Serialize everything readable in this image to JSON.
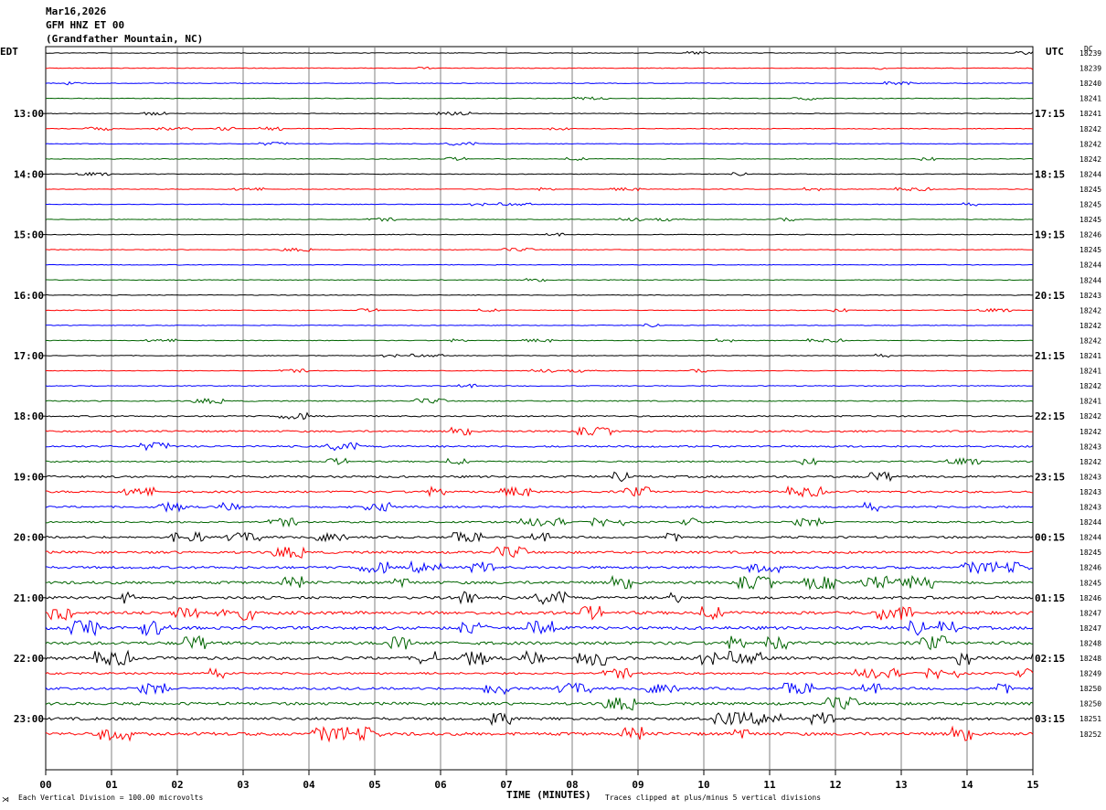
{
  "header": {
    "date": "Mar16,2026",
    "station": "GFM HNZ ET 00",
    "location": "(Grandfather Mountain, NC)"
  },
  "left_tz": "EDT",
  "right_tz": "UTC",
  "dc_label": "DC",
  "footer": {
    "scale_text": "Each Vertical Division =  100.00 microvolts",
    "xlabel": "TIME (MINUTES)",
    "clip_text": "Traces clipped at plus/minus 5 vertical divisions"
  },
  "colors": {
    "black": "#000000",
    "red": "#ff0000",
    "blue": "#0000ff",
    "green": "#006400",
    "grid": "#808080"
  },
  "chart_data": {
    "type": "line",
    "title": "GFM HNZ ET 00",
    "xlabel": "TIME (MINUTES)",
    "xlim": [
      0,
      15
    ],
    "x_ticks": [
      "00",
      "01",
      "02",
      "03",
      "04",
      "05",
      "06",
      "07",
      "08",
      "09",
      "10",
      "11",
      "12",
      "13",
      "14",
      "15"
    ],
    "left_time_labels": [
      "13:00",
      "14:00",
      "15:00",
      "16:00",
      "17:00",
      "18:00",
      "19:00",
      "20:00",
      "21:00",
      "22:00",
      "23:00"
    ],
    "right_time_labels": [
      "17:15",
      "18:15",
      "19:15",
      "20:15",
      "21:15",
      "22:15",
      "23:15",
      "00:15",
      "01:15",
      "02:15",
      "03:15"
    ],
    "trace_colors": [
      "black",
      "red",
      "blue",
      "green"
    ],
    "dc_offsets": [
      "18239",
      "18239",
      "18240",
      "18241",
      "18241",
      "18242",
      "18242",
      "18242",
      "18244",
      "18245",
      "18245",
      "18245",
      "18246",
      "18245",
      "18244",
      "18244",
      "18243",
      "18242",
      "18242",
      "18242",
      "18241",
      "18241",
      "18242",
      "18241",
      "18242",
      "18242",
      "18243",
      "18242",
      "18243",
      "18243",
      "18243",
      "18244",
      "18244",
      "18245",
      "18246",
      "18245",
      "18246",
      "18247",
      "18247",
      "18248",
      "18248",
      "18249",
      "18250",
      "18250",
      "18251",
      "18252"
    ],
    "amplitude_level": [
      0.2,
      0.2,
      0.2,
      0.2,
      0.2,
      0.2,
      0.2,
      0.2,
      0.2,
      0.2,
      0.2,
      0.2,
      0.2,
      0.2,
      0.2,
      0.2,
      0.2,
      0.2,
      0.2,
      0.2,
      0.2,
      0.2,
      0.25,
      0.3,
      0.4,
      0.5,
      0.5,
      0.4,
      0.6,
      0.6,
      0.55,
      0.5,
      0.6,
      0.7,
      0.7,
      0.8,
      0.8,
      0.9,
      0.9,
      0.9,
      0.9,
      0.6,
      0.7,
      0.8,
      0.8,
      0.9
    ]
  }
}
